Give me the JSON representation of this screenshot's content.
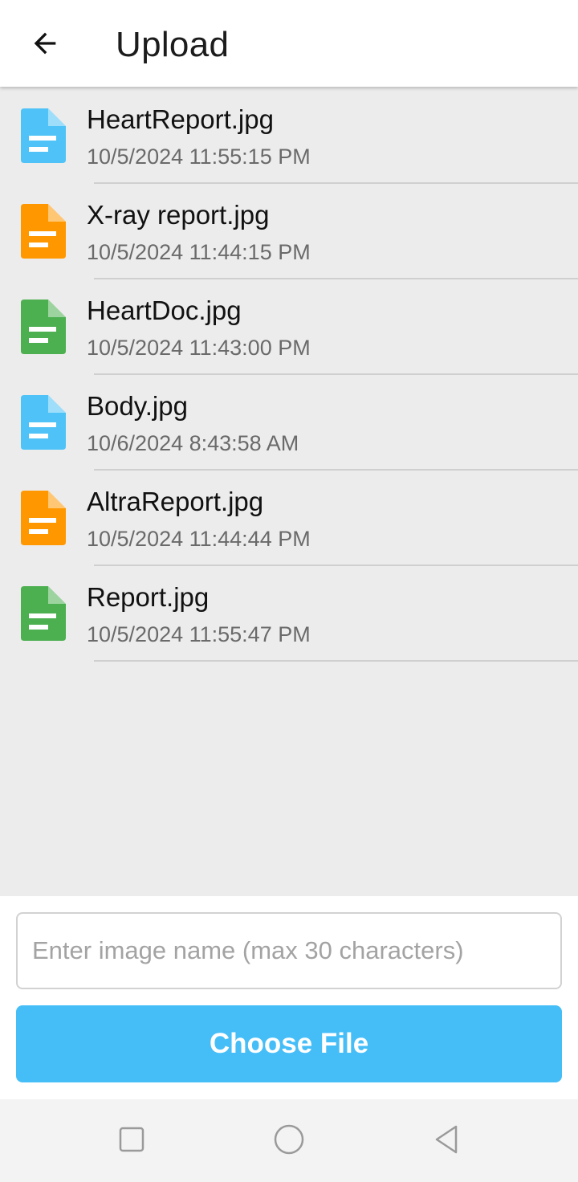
{
  "header": {
    "title": "Upload",
    "back_icon": "arrow-back-icon"
  },
  "colors": {
    "blue": "#4fc3f7",
    "orange": "#ff9800",
    "green": "#4caf50",
    "button": "#45bef8"
  },
  "files": [
    {
      "name": "HeartReport.jpg",
      "date": "10/5/2024 11:55:15 PM",
      "icon": "document-icon",
      "color": "#4fc3f7"
    },
    {
      "name": "X-ray report.jpg",
      "date": "10/5/2024 11:44:15 PM",
      "icon": "document-icon",
      "color": "#ff9800"
    },
    {
      "name": "HeartDoc.jpg",
      "date": "10/5/2024 11:43:00 PM",
      "icon": "document-icon",
      "color": "#4caf50"
    },
    {
      "name": "Body.jpg",
      "date": "10/6/2024 8:43:58 AM",
      "icon": "document-icon",
      "color": "#4fc3f7"
    },
    {
      "name": "AltraReport.jpg",
      "date": "10/5/2024 11:44:44 PM",
      "icon": "document-icon",
      "color": "#ff9800"
    },
    {
      "name": "Report.jpg",
      "date": "10/5/2024 11:55:47 PM",
      "icon": "document-icon",
      "color": "#4caf50"
    }
  ],
  "form": {
    "input_value": "",
    "input_placeholder": "Enter image name (max 30 characters)",
    "choose_label": "Choose File"
  },
  "nav": {
    "recents_icon": "square-recents-icon",
    "home_icon": "circle-home-icon",
    "back_icon": "triangle-back-icon"
  }
}
